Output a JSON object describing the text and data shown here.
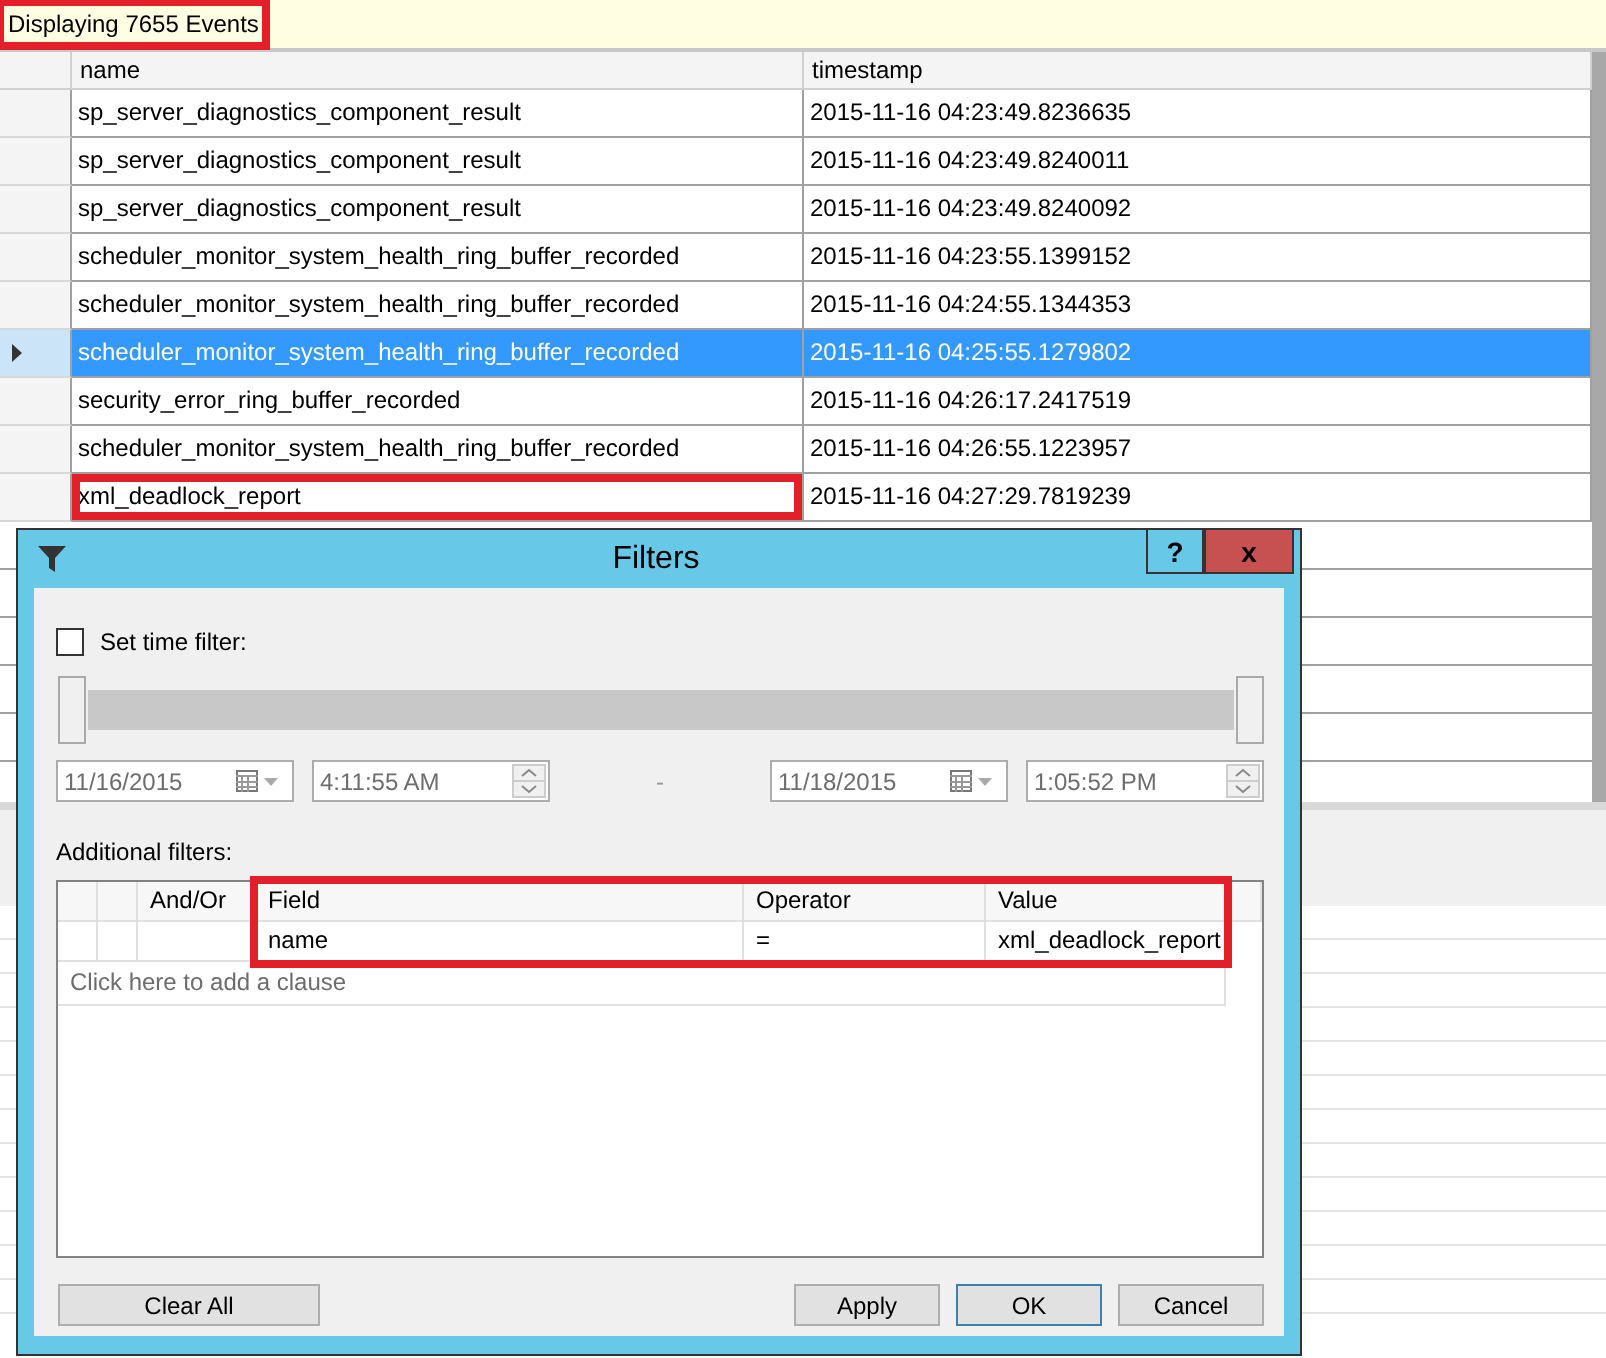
{
  "banner": {
    "text": "Displaying 7655 Events",
    "highlighted": true
  },
  "grid": {
    "columns": [
      "name",
      "timestamp"
    ],
    "rows": [
      {
        "name": "sp_server_diagnostics_component_result",
        "timestamp": "2015-11-16 04:23:49.8236635",
        "selected": false,
        "highlighted": false
      },
      {
        "name": "sp_server_diagnostics_component_result",
        "timestamp": "2015-11-16 04:23:49.8240011",
        "selected": false,
        "highlighted": false
      },
      {
        "name": "sp_server_diagnostics_component_result",
        "timestamp": "2015-11-16 04:23:49.8240092",
        "selected": false,
        "highlighted": false
      },
      {
        "name": "scheduler_monitor_system_health_ring_buffer_recorded",
        "timestamp": "2015-11-16 04:23:55.1399152",
        "selected": false,
        "highlighted": false
      },
      {
        "name": "scheduler_monitor_system_health_ring_buffer_recorded",
        "timestamp": "2015-11-16 04:24:55.1344353",
        "selected": false,
        "highlighted": false
      },
      {
        "name": "scheduler_monitor_system_health_ring_buffer_recorded",
        "timestamp": "2015-11-16 04:25:55.1279802",
        "selected": true,
        "highlighted": false
      },
      {
        "name": "security_error_ring_buffer_recorded",
        "timestamp": "2015-11-16 04:26:17.2417519",
        "selected": false,
        "highlighted": false
      },
      {
        "name": "scheduler_monitor_system_health_ring_buffer_recorded",
        "timestamp": "2015-11-16 04:26:55.1223957",
        "selected": false,
        "highlighted": false
      },
      {
        "name": "xml_deadlock_report",
        "timestamp": "2015-11-16 04:27:29.7819239",
        "selected": false,
        "highlighted": true
      }
    ]
  },
  "dialog": {
    "title": "Filters",
    "help": "?",
    "close": "x",
    "time_filter": {
      "label": "Set time filter:",
      "checked": false,
      "start_date": "11/16/2015",
      "start_time": "4:11:55 AM",
      "separator": "-",
      "end_date": "11/18/2015",
      "end_time": "1:05:52 PM"
    },
    "additional_label": "Additional filters:",
    "filter_table": {
      "columns": [
        "And/Or",
        "Field",
        "Operator",
        "Value"
      ],
      "highlighted": true,
      "rows": [
        {
          "field": "name",
          "operator": "=",
          "value": "xml_deadlock_report"
        }
      ],
      "add_clause": "Click here to add a clause"
    },
    "buttons": [
      {
        "label": "Clear All",
        "default": false
      },
      {
        "label": "Apply",
        "default": false
      },
      {
        "label": "OK",
        "default": true
      },
      {
        "label": "Cancel",
        "default": false
      }
    ]
  }
}
